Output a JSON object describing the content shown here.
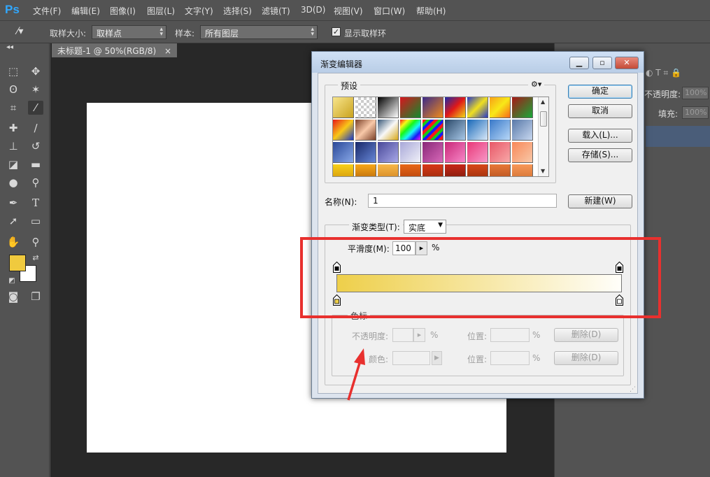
{
  "app": {
    "logo": "Ps",
    "menu": [
      "文件(F)",
      "编辑(E)",
      "图像(I)",
      "图层(L)",
      "文字(Y)",
      "选择(S)",
      "滤镜(T)",
      "3D(D)",
      "视图(V)",
      "窗口(W)",
      "帮助(H)"
    ]
  },
  "options_bar": {
    "sample_size_label": "取样大小:",
    "sample_size_value": "取样点",
    "sample_label": "样本:",
    "sample_value": "所有图层",
    "show_ring_checked": true,
    "show_ring_label": "显示取样环"
  },
  "document": {
    "tab_title": "未标题-1 @ 50%(RGB/8)",
    "close_glyph": "×"
  },
  "right_panel": {
    "opacity_label": "不透明度:",
    "opacity_value": "100%",
    "fill_label": "填充:",
    "fill_value": "100%"
  },
  "colors": {
    "foreground": "#f0ca3e",
    "background": "#ffffff",
    "gradient_start": "#eecf4a",
    "gradient_end": "#fffefa",
    "highlight": "#e8302e"
  },
  "dialog": {
    "title": "渐变编辑器",
    "presets_label": "预设",
    "gear_icon": "⚙▾",
    "buttons": {
      "ok": "确定",
      "cancel": "取消",
      "load": "载入(L)...",
      "save": "存储(S)...",
      "new": "新建(W)"
    },
    "name_label": "名称(N):",
    "name_value": "1",
    "gradient_type_label": "渐变类型(T):",
    "gradient_type_value": "实底",
    "smoothness_label": "平滑度(M):",
    "smoothness_value": "100",
    "percent": "%",
    "stops_label": "色标",
    "stop_opacity_label": "不透明度:",
    "stop_location_label": "位置:",
    "stop_delete_label": "删除(D)",
    "stop_color_label": "颜色:"
  }
}
